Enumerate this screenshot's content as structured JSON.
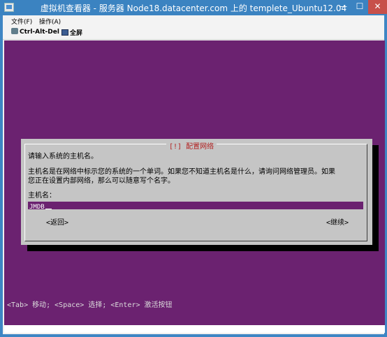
{
  "window": {
    "title": "虚拟机查看器 - 服务器 Node18.datacenter.com 上的 templete_Ubuntu12.04",
    "min_glyph": "—",
    "max_glyph": "☐",
    "close_glyph": "✕",
    "close_color": "#c7504a",
    "frame_color": "#3b83c1"
  },
  "menu": {
    "items": [
      {
        "label": "文件(F)"
      },
      {
        "label": "操作(A)"
      }
    ]
  },
  "toolbar": {
    "cad_label": "Ctrl-Alt-Del",
    "fullscreen_label": "全屏"
  },
  "console": {
    "bg_color": "#6b2270",
    "dialog": {
      "title": "[!] 配置网络",
      "prompt": "请输入系统的主机名。",
      "desc_line1": "主机名是在网络中标示您的系统的一个单词。如果您不知道主机名是什么，请询问网络管理员。如果",
      "desc_line2": "您正在设置内部网络，那么可以随意写个名字。",
      "field_label": "主机名：",
      "field_value": "JMDB",
      "back_button": "<返回>",
      "continue_button": "<继续>"
    },
    "status_bar": "<Tab> 移动; <Space> 选择; <Enter> 激活按钮"
  }
}
